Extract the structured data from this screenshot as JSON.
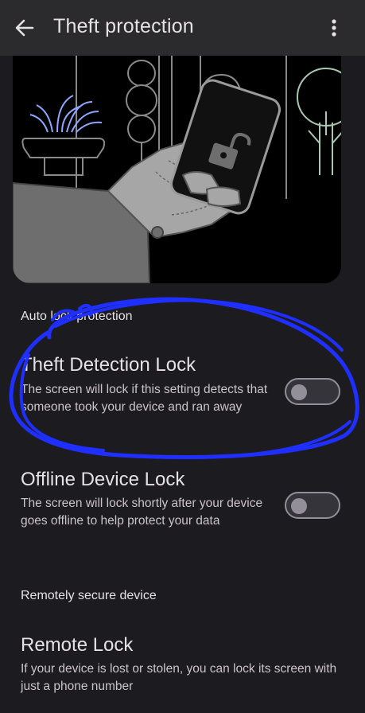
{
  "app_bar": {
    "title": "Theft protection",
    "back_icon": "arrow-back-icon",
    "menu_icon": "more-vert-icon"
  },
  "hero": {
    "icon": "unlocked-phone-illustration"
  },
  "sections": {
    "auto_lock_header": "Auto lock protection",
    "remote_header": "Remotely secure device"
  },
  "settings": {
    "theft_detection": {
      "title": "Theft Detection Lock",
      "description": "The screen will lock if this setting detects that someone took your device and ran away",
      "enabled": false
    },
    "offline_device": {
      "title": "Offline Device Lock",
      "description": "The screen will lock shortly after your device goes offline to help protect your data",
      "enabled": false
    },
    "remote_lock": {
      "title": "Remote Lock",
      "description": "If your device is lost or stolen, you can lock its screen with just a phone number"
    }
  },
  "colors": {
    "background": "#1c1b1f",
    "app_bar": "#2b2b2e",
    "annotation": "#1f2fff"
  }
}
